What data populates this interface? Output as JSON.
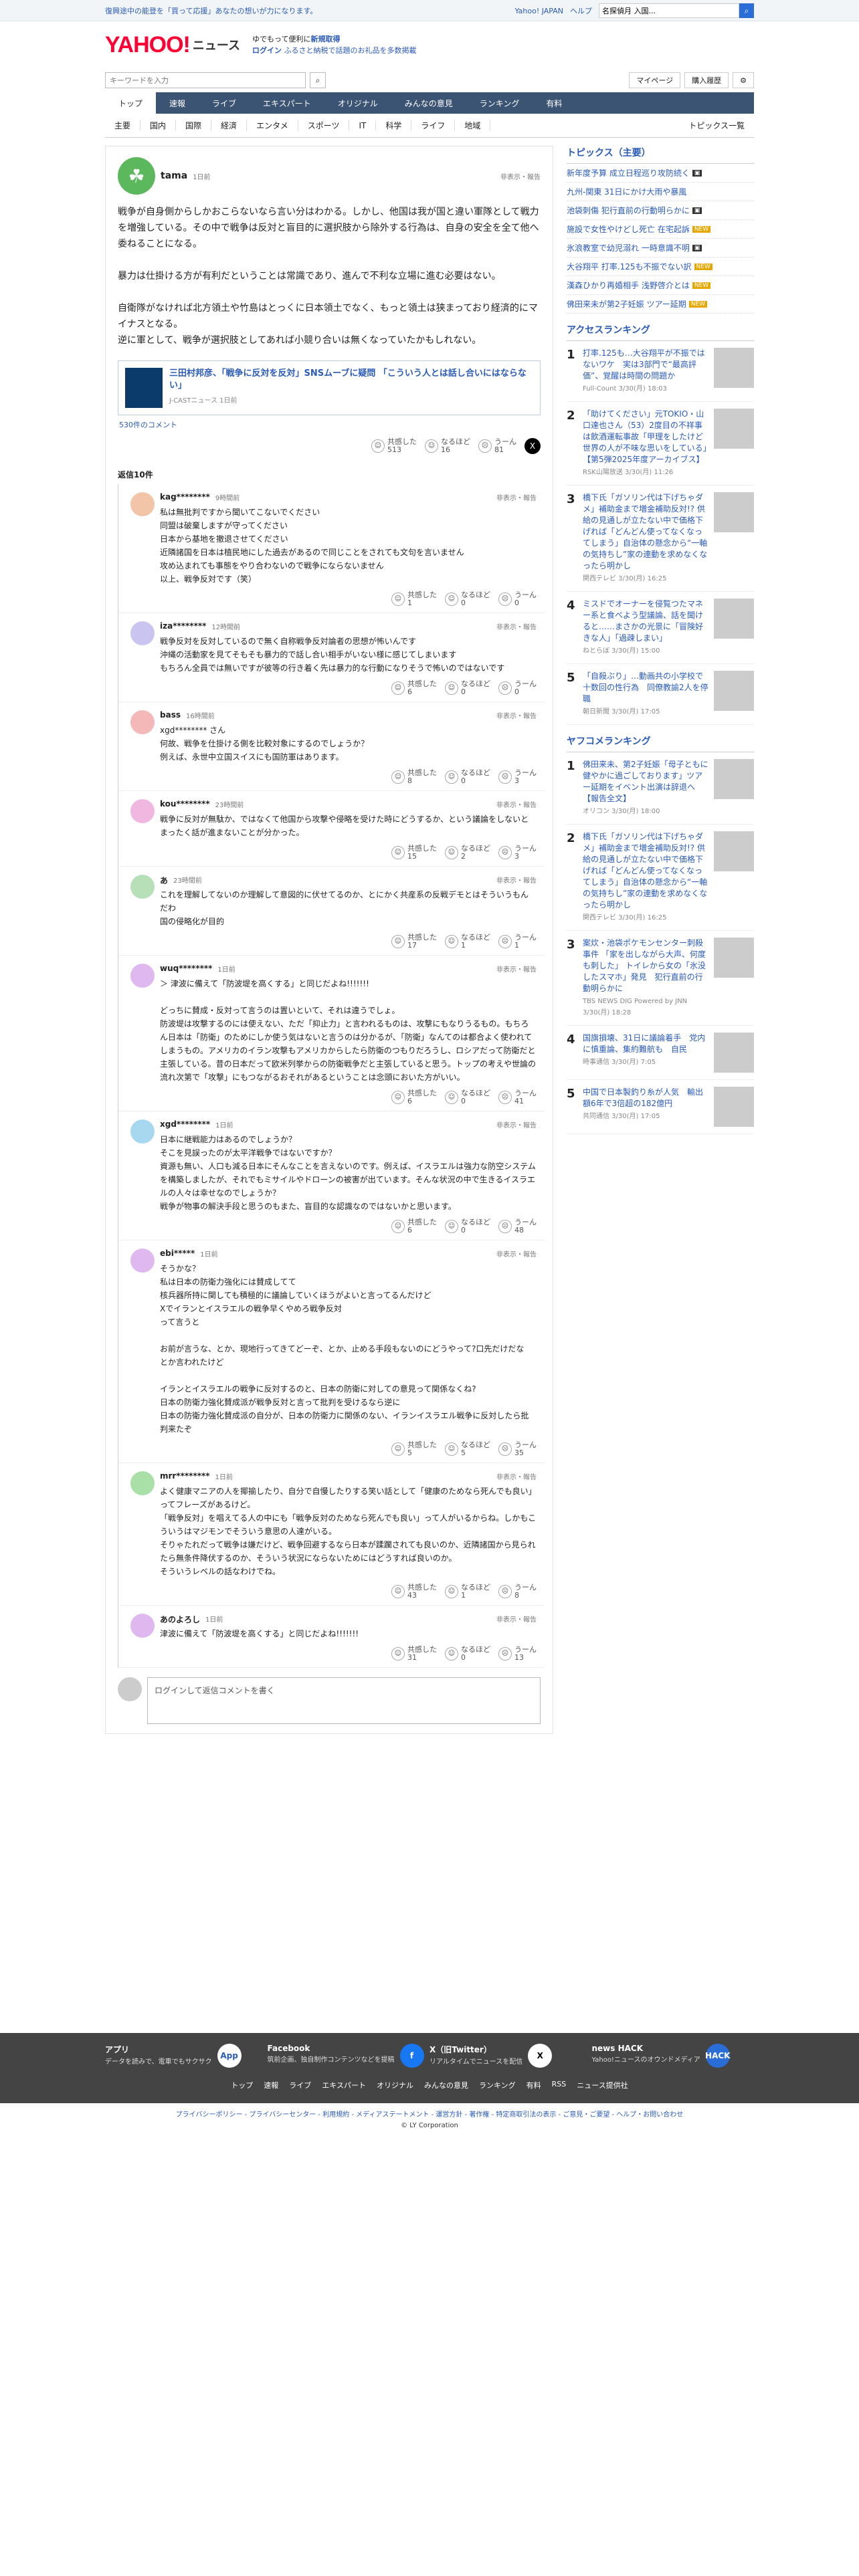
{
  "topbar": {
    "notice": "復興途中の能登を「買って応援」あなたの想いが力になります。",
    "links": [
      "Yahoo! JAPAN",
      "ヘルプ"
    ],
    "search_placeholder": "キーワードを入力",
    "search_value": "名探偵月 入国..."
  },
  "header": {
    "logo": "YAHOO!",
    "logo_sub": "ニュース",
    "promo_line1": "ゆでもって便利に",
    "promo_line1b": "新規取得",
    "promo_line2": "ログイン",
    "promo_line2b": "ふるさと納税で話題のお礼品を多数掲載"
  },
  "search": {
    "placeholder": "キーワードを入力",
    "mypage": "マイページ",
    "history": "購入履歴"
  },
  "gnav": [
    "トップ",
    "速報",
    "ライブ",
    "エキスパート",
    "オリジナル",
    "みんなの意見",
    "ランキング",
    "有料"
  ],
  "snav": [
    "主要",
    "国内",
    "国際",
    "経済",
    "エンタメ",
    "スポーツ",
    "IT",
    "科学",
    "ライフ",
    "地域"
  ],
  "snav_right": "トピックス一覧",
  "parent": {
    "user": "tama",
    "time": "1日前",
    "report": "非表示・報告",
    "text": "戦争が自身側からしかおこらないなら言い分はわかる。しかし、他国は我が国と違い軍隊として戦力を増強している。その中で戦争は反対と盲目的に選択肢から除外する行為は、自身の安全を全て他へ委ねることになる。\n\n暴力は仕掛ける方が有利だということは常識であり、進んで不利な立場に進む必要はない。\n\n自衛隊がなければ北方領土や竹島はとっくに日本領土でなく、もっと領土は狭まっており経済的にマイナスとなる。\n逆に軍として、戦争が選択肢としてあれば小競り合いは無くなっていたかもしれない。",
    "article_title": "三田村邦彦、「戦争に反対を反対」SNSムーブに疑問 「こういう人とは話し合いにはならない」",
    "article_src": "J-CASTニュース 1日前",
    "comments_link": "530件のコメント",
    "reactions": [
      {
        "label": "共感した",
        "count": "513"
      },
      {
        "label": "なるほど",
        "count": "16"
      },
      {
        "label": "うーん",
        "count": "81"
      }
    ]
  },
  "reply_count": "返信10件",
  "replies": [
    {
      "user": "kag********",
      "time": "9時間前",
      "text": "私は無批判ですから聞いてこないでください\n同盟は破棄しますが守ってください\n日本から基地を撤退させてください\n近隣諸国を日本は植民地にした過去があるので同じことをされても文句を言いません\n攻め込まれても事態をやり合わないので戦争にならないません\n以上、戦争反対です（笑）",
      "r": [
        "1",
        "0",
        "0"
      ]
    },
    {
      "user": "iza********",
      "time": "12時間前",
      "text": "戦争反対を反対しているので無く自称戦争反対論者の思想が怖いんです\n沖縄の活動家を見てそもそも暴力的で話し合い相手がいない様に感じてしまいます\nもちろん全員では無いですが彼等の行き着く先は暴力的な行動になりそうで怖いのではないです",
      "r": [
        "6",
        "0",
        "0"
      ]
    },
    {
      "user": "bass",
      "time": "16時間前",
      "text": "xgd******** さん\n何故、戦争を仕掛ける側を比較対象にするのでしょうか？\n例えば、永世中立国スイスにも国防軍はあります。",
      "r": [
        "8",
        "0",
        "3"
      ]
    },
    {
      "user": "kou********",
      "time": "23時間前",
      "text": "戦争に反対が無駄か、ではなくて他国から攻撃や侵略を受けた時にどうするか、という議論をしないとまったく話が進まないことが分かった。",
      "r": [
        "15",
        "2",
        "3"
      ]
    },
    {
      "user": "あ",
      "time": "23時間前",
      "text": "これを理解してないのか理解して意図的に伏せてるのか、とにかく共産系の反戦デモとはそういうもんだわ\n国の侵略化が目的",
      "r": [
        "17",
        "1",
        "1"
      ]
    },
    {
      "user": "wuq********",
      "time": "1日前",
      "text": "＞ 津波に備えて「防波堤を高くする」と同じだよね!!!!!!!\n\nどっちに賛成・反対って言うのは置いといて、それは違うでしょ。\n防波堤は攻撃するのには使えない、ただ「抑止力」と言われるものは、攻撃にもなりうるもの。もちろん日本は「防衛」のためにしか使う気はないと言うのは分かるが、「防衛」なんてのは都合よく使われてしまうもの。アメリカのイラン攻撃もアメリカからしたら防衛のつもりだろうし、ロシアだって防衛だと主張している。昔の日本だって欧米列挙からの防衛戦争だと主張していると思う。トップの考えや世論の流れ次第で「攻撃」にもつながるおそれがあるということは念頭においた方がいい。",
      "r": [
        "6",
        "0",
        "41"
      ]
    },
    {
      "user": "xgd********",
      "time": "1日前",
      "text": "日本に継戦能力はあるのでしょうか？\nそこを見誤ったのが太平洋戦争ではないですか？\n資源も無い、人口も減る日本にそんなことを言えないのです。例えば、イスラエルは強力な防空システムを構築しましたが、それでもミサイルやドローンの被害が出ています。そんな状況の中で生きるイスラエルの人々は幸せなのでしょうか？\n戦争が物事の解決手段と思うのもまた、盲目的な認識なのではないかと思います。",
      "r": [
        "6",
        "0",
        "48"
      ]
    },
    {
      "user": "ebi*****",
      "time": "1日前",
      "text": "そうかな？\n私は日本の防衛力強化には賛成してて\n核兵器所持に関しても積極的に議論していくほうがよいと言ってるんだけど\nXでイランとイスラエルの戦争早くやめろ戦争反対\nって言うと\n\nお前が言うな、とか、現地行ってきてどーぞ、とか、止める手段もないのにどうやって?口先だけだな\nとか言われたけど\n\nイランとイスラエルの戦争に反対するのと、日本の防衛に対しての意見って関係なくね?\n日本の防衛力強化賛成派が戦争反対と言って批判を受けるなら逆に\n日本の防衛力強化賛成派の自分が、日本の防衛力に関係のない、イランイスラエル戦争に反対したら批判来たぞ",
      "r": [
        "5",
        "5",
        "35"
      ]
    },
    {
      "user": "mrr********",
      "time": "1日前",
      "text": "よく健康マニアの人を揶揄したり、自分で自慢したりする笑い話として「健康のためなら死んでも良い」ってフレーズがあるけど。\n「戦争反対」を唱えてる人の中にも「戦争反対のためなら死んでも良い」って人がいるからね。しかもこういうはマジモンでそういう意思の人達がいる。\nそりゃたれだって戦争は嫌だけど、戦争回避するなら日本が蹂躙されても良いのか、近隣諸国から見られたら無条件降伏するのか、そういう状況にならないためにはどうすれば良いのか。\nそういうレベルの話なわけでね。",
      "r": [
        "43",
        "1",
        "8"
      ]
    },
    {
      "user": "あのよろし",
      "time": "1日前",
      "text": "津波に備えて「防波堤を高くする」と同じだよね!!!!!!!",
      "r": [
        "31",
        "0",
        "13"
      ]
    }
  ],
  "reply_box_placeholder": "ログインして返信コメントを書く",
  "react_labels": [
    "共感した",
    "なるほど",
    "うーん"
  ],
  "sidebar": {
    "topics_title": "トピックス（主要）",
    "topics": [
      {
        "text": "新年度予算 成立日程巡り攻防続く",
        "badge": "img"
      },
      {
        "text": "九州-関東 31日にかけ大雨や暴風",
        "badge": ""
      },
      {
        "text": "池袋刺傷 犯行直前の行動明らかに",
        "badge": "img"
      },
      {
        "text": "施設で女性やけどし死亡 在宅起訴",
        "badge": "new"
      },
      {
        "text": "氷浪教室で幼児溺れ 一時意識不明",
        "badge": "img"
      },
      {
        "text": "大谷翔平 打率.125も不振でない訳",
        "badge": "new"
      },
      {
        "text": "漢森ひかり再婚相手 浅野啓介とは",
        "badge": "new"
      },
      {
        "text": "佛田来未が第2子妊娠 ツアー延期",
        "badge": "new"
      }
    ],
    "access_title": "アクセスランキング",
    "access": [
      {
        "n": "1",
        "t": "打率.125も…大谷翔平が不振ではないワケ　実は3部門で“最高評価”、覚醒は時間の問題か",
        "s": "Full-Count 3/30(月) 18:03"
      },
      {
        "n": "2",
        "t": "「助けてください」元TOKIO・山口達也さん（53）2度目の不祥事は飲酒運転事故「甲理をしたけど世界の人が不味な思いをしている」【第5弾2025年度アーカイブス】",
        "s": "RSK山陽放送 3/30(月) 11:26"
      },
      {
        "n": "3",
        "t": "橋下氏「ガソリン代は下げちゃダメ」補助金まで増金補助反対!? 供給の見通しが立たない中で価格下げれば「どんどん使ってなくなってしまう」自治体の懸念から“一軸の気持ちし”家の連動を求めなくなったら明かし",
        "s": "関西テレビ 3/30(月) 16:25"
      },
      {
        "n": "4",
        "t": "ミスドでオーナーを侵覧つたマネー系と食べよう型議論、話を聞けると……まさかの光景に「冒険好きな人」「過疎しまい」",
        "s": "ねとらぼ 3/30(月) 15:00"
      },
      {
        "n": "5",
        "t": "「自殺ぶり」…動画共の小学校で十数回の性行為　同僚教諭2人を停職",
        "s": "朝日新聞 3/30(月) 17:05"
      }
    ],
    "yafoo_title": "ヤフコメランキング",
    "yafoo": [
      {
        "n": "1",
        "t": "佛田来未、第2子妊娠「母子ともに健やかに過ごしております」ツアー延期をイベント出演は辞退へ【報告全文】",
        "s": "オリコン 3/30(月) 18:00"
      },
      {
        "n": "2",
        "t": "橋下氏「ガソリン代は下げちゃダメ」補助金まで増金補助反対!? 供給の見通しが立たない中で価格下げれば「どんどん使ってなくなってしまう」自治体の懸念から“一軸の気持ちし”家の連動を求めなくなったら明かし",
        "s": "関西テレビ 3/30(月) 16:25"
      },
      {
        "n": "3",
        "t": "案炊・池袋ポケモンセンター刺殺事件 「家を出しながら大声、何度も刺した」 トイレから女の「氷没したスマホ」発見　犯行直前の行動明らかに",
        "s": "TBS NEWS DIG Powered by JNN 3/30(月) 18:28"
      },
      {
        "n": "4",
        "t": "国旗損壊、31日に議論着手　党内に慎重論、集約難航も　自民",
        "s": "時事通信 3/30(月) 7:05"
      },
      {
        "n": "5",
        "t": "中国で日本製釣り糸が人気　輸出額6年で3倍超の182億円",
        "s": "共同通信 3/30(月) 17:05"
      }
    ]
  },
  "footer": {
    "cells": [
      {
        "label": "アプリ",
        "desc": "データを読みで、電車でもサクサク",
        "icon": "app-icon",
        "icon_text": "App"
      },
      {
        "label": "Facebook",
        "desc": "筑前企画、独自制作コンテンツなどを提稿",
        "icon": "facebook-icon",
        "icon_text": "f"
      },
      {
        "label": "X（旧Twitter）",
        "desc": "リアルタイムでニュースを配信",
        "icon": "x-icon",
        "icon_text": "X"
      },
      {
        "label": "news HACK",
        "desc": "Yahoo!ニュースのオウンドメディア",
        "icon": "newshack-icon",
        "icon_text": "HACK"
      }
    ],
    "nav": [
      "トップ",
      "速報",
      "ライブ",
      "エキスパート",
      "オリジナル",
      "みんなの意見",
      "ランキング",
      "有料",
      "RSS",
      "ニュース提供社"
    ],
    "links": "プライバシーポリシー - プライバシーセンター - 利用規約 - メディアステートメント - 運営方針 - 著作権 - 特定商取引法の表示 - ご意見・ご要望 - ヘルプ・お問い合わせ",
    "copyright": "© LY Corporation"
  },
  "colors": {
    "accent": "#2a5bb8",
    "nav": "#3c5474",
    "logo": "#ff0033"
  }
}
